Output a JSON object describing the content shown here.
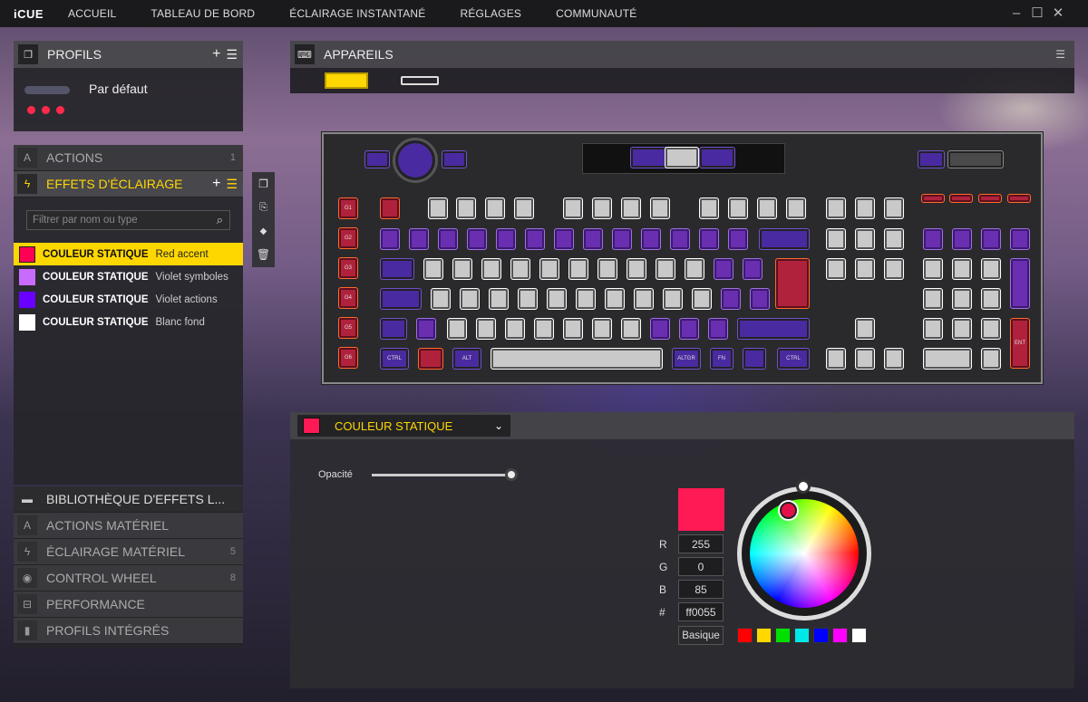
{
  "app": {
    "logo": "iCUE",
    "nav": [
      "ACCUEIL",
      "TABLEAU DE BORD",
      "ÉCLAIRAGE INSTANTANÉ",
      "RÉGLAGES",
      "COMMUNAUTÉ"
    ]
  },
  "profiles": {
    "title": "PROFILS",
    "current": "Par défaut"
  },
  "actions": {
    "label": "ACTIONS",
    "count": "1"
  },
  "lighting": {
    "title": "EFFETS D'ÉCLAIRAGE",
    "filter_placeholder": "Filtrer par nom ou type",
    "effects": [
      {
        "type": "COULEUR STATIQUE",
        "name": "Red accent",
        "color": "#ff0055"
      },
      {
        "type": "COULEUR STATIQUE",
        "name": "Violet symboles",
        "color": "#c86cff"
      },
      {
        "type": "COULEUR STATIQUE",
        "name": "Violet actions",
        "color": "#6a00ff"
      },
      {
        "type": "COULEUR STATIQUE",
        "name": "Blanc fond",
        "color": "#ffffff"
      }
    ]
  },
  "library": {
    "title": "BIBLIOTHÈQUE D'EFFETS L...",
    "items": [
      {
        "label": "ACTIONS MATÉRIEL",
        "count": ""
      },
      {
        "label": "ÉCLAIRAGE MATÉRIEL",
        "count": "5"
      },
      {
        "label": "CONTROL WHEEL",
        "count": "8"
      },
      {
        "label": "PERFORMANCE",
        "count": ""
      },
      {
        "label": "PROFILS INTÉGRÉS",
        "count": ""
      }
    ]
  },
  "devices": {
    "title": "APPAREILS"
  },
  "editor": {
    "effect_type": "COULEUR STATIQUE",
    "opacity_label": "Opacité",
    "opacity_value": 1.0,
    "r_label": "R",
    "g_label": "G",
    "b_label": "B",
    "hex_label": "#",
    "r": "255",
    "g": "0",
    "b": "85",
    "hex": "ff0055",
    "basic_label": "Basique",
    "color": "#ff1a55",
    "presets": [
      "#ff0000",
      "#ffd800",
      "#00e000",
      "#00e8e8",
      "#0000ff",
      "#ff00ff",
      "#ffffff"
    ]
  },
  "keyboard": {
    "gkeys": [
      "G1",
      "G2",
      "G3",
      "G4",
      "G5",
      "G6"
    ],
    "mods": {
      "ctrl": "CTRL",
      "alt": "ALT",
      "altgr": "ALTGR",
      "fn": "FN",
      "ctrl2": "CTRL",
      "ent": "ENT"
    }
  },
  "colors": {
    "accent": "#ffd700",
    "selected": "#ffd700"
  }
}
